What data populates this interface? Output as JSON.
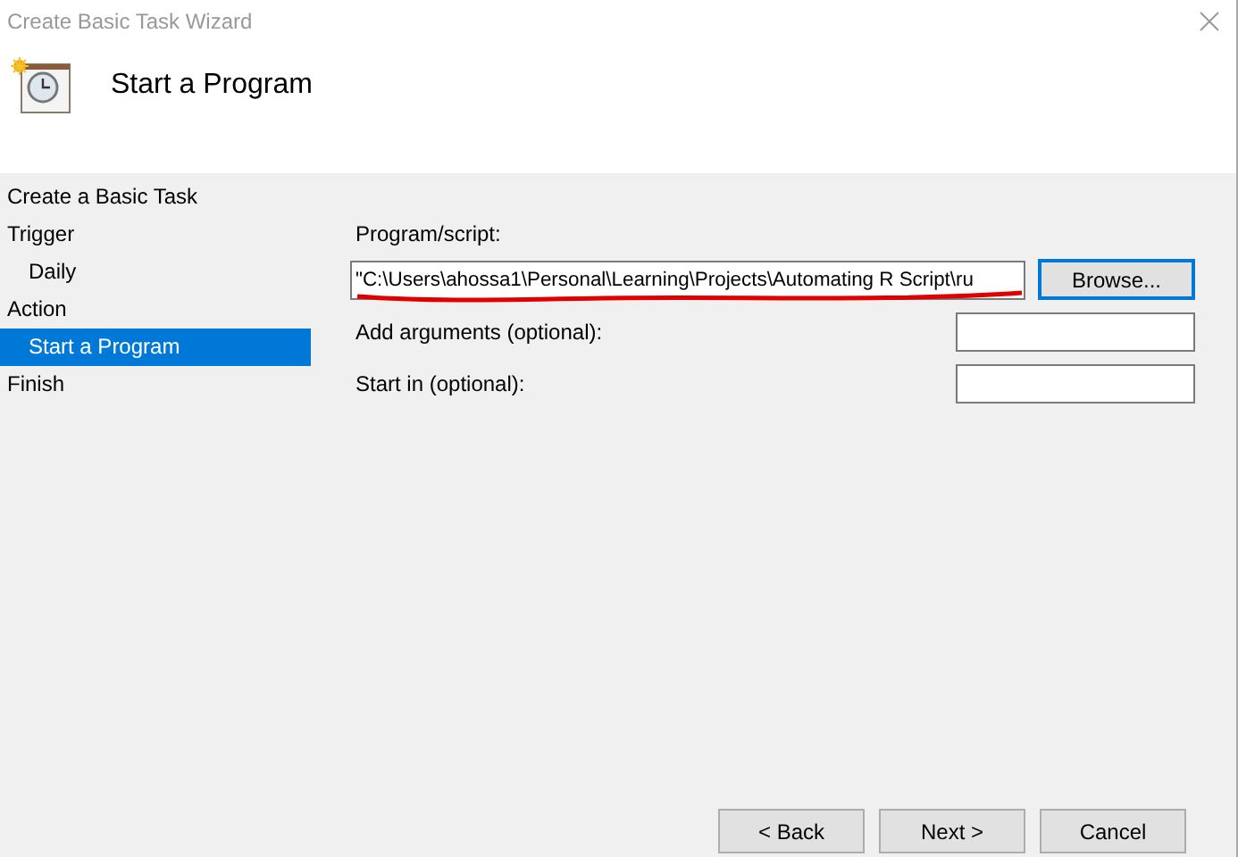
{
  "window": {
    "title": "Create Basic Task Wizard"
  },
  "header": {
    "title": "Start a Program"
  },
  "sidebar": {
    "items": [
      {
        "label": "Create a Basic Task",
        "selected": false
      },
      {
        "label": "Trigger",
        "selected": false,
        "children": [
          {
            "label": "Daily",
            "selected": false
          }
        ]
      },
      {
        "label": "Action",
        "selected": false,
        "children": [
          {
            "label": "Start a Program",
            "selected": true
          }
        ]
      },
      {
        "label": "Finish",
        "selected": false
      }
    ]
  },
  "form": {
    "program_label": "Program/script:",
    "program_value": "\"C:\\Users\\ahossa1\\Personal\\Learning\\Projects\\Automating R Script\\ru",
    "browse_button": "Browse...",
    "fields": [
      {
        "label": "Add arguments (optional):"
      },
      {
        "label": "Start in (optional):"
      }
    ]
  },
  "buttons": [
    {
      "label": "< Back"
    },
    {
      "label": "Next >"
    },
    {
      "label": "Cancel"
    }
  ]
}
